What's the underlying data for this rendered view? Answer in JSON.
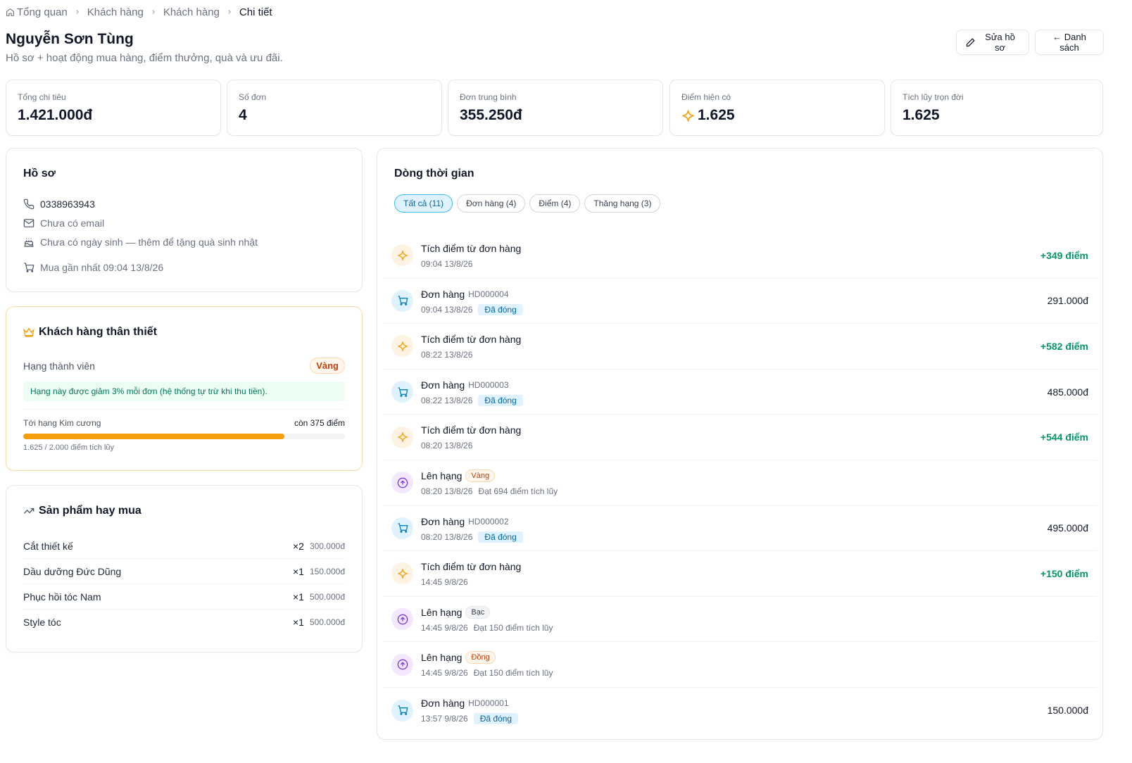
{
  "breadcrumb": {
    "items": [
      "Tổng quan",
      "Khách hàng",
      "Khách hàng"
    ],
    "current": "Chi tiết"
  },
  "header": {
    "title": "Nguyễn Sơn Tùng",
    "subtitle": "Hồ sơ + hoạt động mua hàng, điểm thưởng, quà và ưu đãi.",
    "edit_label": "Sửa hồ sơ",
    "back_label": "← Danh sách"
  },
  "stats": [
    {
      "label": "Tổng chi tiêu",
      "value": "1.421.000đ"
    },
    {
      "label": "Số đơn",
      "value": "4"
    },
    {
      "label": "Đơn trung bình",
      "value": "355.250đ"
    },
    {
      "label": "Điểm hiện có",
      "value": "1.625"
    },
    {
      "label": "Tích lũy trọn đời",
      "value": "1.625"
    }
  ],
  "profile": {
    "title": "Hồ sơ",
    "phone": "0338963943",
    "email": "Chưa có email",
    "birthday": "Chưa có ngày sinh — thêm để tặng quà sinh nhật",
    "last_purchase": "Mua gần nhất 09:04 13/8/26"
  },
  "loyalty": {
    "title": "Khách hàng thân thiết",
    "tier_label": "Hạng thành viên",
    "tier_value": "Vàng",
    "tier_note": "Hạng này được giảm 3% mỗi đơn (hệ thống tự trừ khi thu tiền).",
    "next_tier_label": "Tới hạng Kim cương",
    "remaining": "còn 375 điểm",
    "progress_fraction": 0.8125,
    "progress_caption": "1.625 / 2.000 điểm tích lũy",
    "accent_color": "#f59e0b"
  },
  "products": {
    "title": "Sản phẩm hay mua",
    "items": [
      {
        "name": "Cắt thiết kế",
        "qty": "×2",
        "price": "300.000đ"
      },
      {
        "name": "Dầu dưỡng Đức Dũng",
        "qty": "×1",
        "price": "150.000đ"
      },
      {
        "name": "Phục hồi tóc Nam",
        "qty": "×1",
        "price": "500.000đ"
      },
      {
        "name": "Style tóc",
        "qty": "×1",
        "price": "500.000đ"
      }
    ]
  },
  "timeline": {
    "title": "Dòng thời gian",
    "tabs": [
      {
        "label": "Tất cả (11)",
        "active": true
      },
      {
        "label": "Đơn hàng (4)",
        "active": false
      },
      {
        "label": "Điểm (4)",
        "active": false
      },
      {
        "label": "Thăng hạng (3)",
        "active": false
      }
    ],
    "items": [
      {
        "kind": "points",
        "icon": "sparkle-icon",
        "title": "Tích điểm từ đơn hàng",
        "time": "09:04 13/8/26",
        "right": "+349 điểm"
      },
      {
        "kind": "order",
        "icon": "cart-icon",
        "title": "Đơn hàng",
        "code": "HD000004",
        "time": "09:04 13/8/26",
        "status": "Đã đóng",
        "right": "291.000đ"
      },
      {
        "kind": "points",
        "icon": "sparkle-icon",
        "title": "Tích điểm từ đơn hàng",
        "time": "08:22 13/8/26",
        "right": "+582 điểm"
      },
      {
        "kind": "order",
        "icon": "cart-icon",
        "title": "Đơn hàng",
        "code": "HD000003",
        "time": "08:22 13/8/26",
        "status": "Đã đóng",
        "right": "485.000đ"
      },
      {
        "kind": "points",
        "icon": "sparkle-icon",
        "title": "Tích điểm từ đơn hàng",
        "time": "08:20 13/8/26",
        "right": "+544 điểm"
      },
      {
        "kind": "tier",
        "icon": "arrow-up-circle-icon",
        "title": "Lên hạng",
        "tier": "Vàng",
        "tier_style": "gold",
        "time": "08:20 13/8/26",
        "note": "Đạt 694 điểm tích lũy"
      },
      {
        "kind": "order",
        "icon": "cart-icon",
        "title": "Đơn hàng",
        "code": "HD000002",
        "time": "08:20 13/8/26",
        "status": "Đã đóng",
        "right": "495.000đ"
      },
      {
        "kind": "points",
        "icon": "sparkle-icon",
        "title": "Tích điểm từ đơn hàng",
        "time": "14:45 9/8/26",
        "right": "+150 điểm"
      },
      {
        "kind": "tier",
        "icon": "arrow-up-circle-icon",
        "title": "Lên hạng",
        "tier": "Bạc",
        "tier_style": "silver",
        "time": "14:45 9/8/26",
        "note": "Đạt 150 điểm tích lũy"
      },
      {
        "kind": "tier",
        "icon": "arrow-up-circle-icon",
        "title": "Lên hạng",
        "tier": "Đồng",
        "tier_style": "gold",
        "time": "14:45 9/8/26",
        "note": "Đạt 150 điểm tích lũy"
      },
      {
        "kind": "order",
        "icon": "cart-icon",
        "title": "Đơn hàng",
        "code": "HD000001",
        "time": "13:57 9/8/26",
        "status": "Đã đóng",
        "right": "150.000đ"
      }
    ]
  }
}
